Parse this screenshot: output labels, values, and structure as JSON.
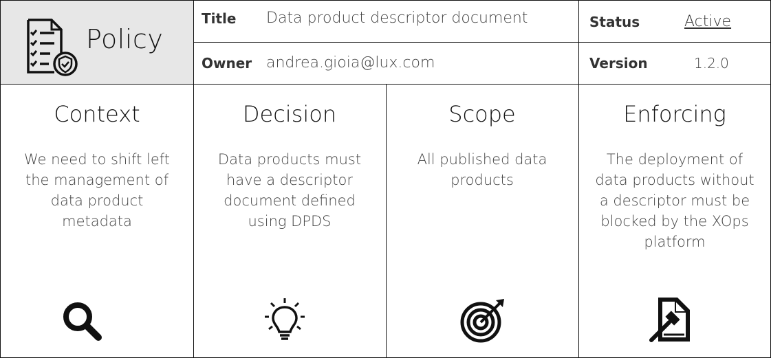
{
  "header": {
    "policy_label": "Policy",
    "title_label": "Title",
    "title_value": "Data product descriptor document",
    "owner_label": "Owner",
    "owner_value": "andrea.gioia@lux.com",
    "status_label": "Status",
    "status_value": "Active",
    "version_label": "Version",
    "version_value": "1.2.0"
  },
  "columns": [
    {
      "title": "Context",
      "body": "We need to shift left the management of data product metadata",
      "icon": "magnifier-icon"
    },
    {
      "title": "Decision",
      "body": "Data products must have a descriptor document defined using DPDS",
      "icon": "lightbulb-icon"
    },
    {
      "title": "Scope",
      "body": "All published data products",
      "icon": "target-icon"
    },
    {
      "title": "Enforcing",
      "body": "The deployment of data products without a descriptor must be blocked by the XOps platform",
      "icon": "gavel-document-icon"
    }
  ],
  "colors": {
    "header_bg": "#e7e7e7",
    "border": "#111111",
    "text": "#444444"
  }
}
